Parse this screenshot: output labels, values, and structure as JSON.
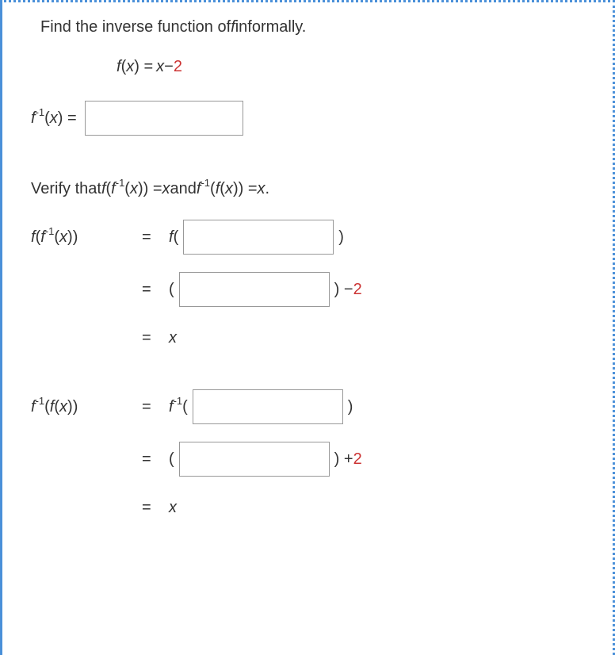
{
  "prompt": {
    "line1_a": "Find the inverse function of ",
    "line1_f": "f",
    "line1_b": " informally."
  },
  "given": {
    "fx": "f",
    "open": "(",
    "x": "x",
    "close": ") = ",
    "xvar": "x",
    "minus": " − ",
    "two": "2"
  },
  "inverse_label": {
    "f": "f",
    "exp": " -1",
    "open": "(",
    "x": "x",
    "close": ") ="
  },
  "verify": {
    "pre": "Verify that ",
    "f1": "f",
    "open1": "(",
    "f2": "f",
    "exp": " -1",
    "open2": "(",
    "x1": "x",
    "close2": ")) = ",
    "x2": "x",
    "and": " and ",
    "f3": "f",
    "exp2": " -1",
    "open3": "(",
    "f4": "f",
    "open4": "(",
    "x3": "x",
    "close4": ")) = ",
    "x4": "x",
    "dot": "."
  },
  "proof1": {
    "lhs_f": "f",
    "lhs_open": "(",
    "lhs_f2": "f",
    "lhs_exp": " -1",
    "lhs_open2": "(",
    "lhs_x": "x",
    "lhs_close": "))",
    "step1_eq": "=",
    "step1_f": "f",
    "step1_open": "(",
    "step1_close": ")",
    "step2_eq": "=",
    "step2_open": "(",
    "step2_close": ") − ",
    "step2_two": "2",
    "step3_eq": "=",
    "step3_x": "x"
  },
  "proof2": {
    "lhs_f": "f",
    "lhs_exp": " -1",
    "lhs_open": "(",
    "lhs_f2": "f",
    "lhs_open2": "(",
    "lhs_x": "x",
    "lhs_close": "))",
    "step1_eq": "=",
    "step1_f": "f",
    "step1_exp": " -1",
    "step1_open": "(",
    "step1_close": ")",
    "step2_eq": "=",
    "step2_open": "(",
    "step2_close": ") + ",
    "step2_two": "2",
    "step3_eq": "=",
    "step3_x": "x"
  }
}
